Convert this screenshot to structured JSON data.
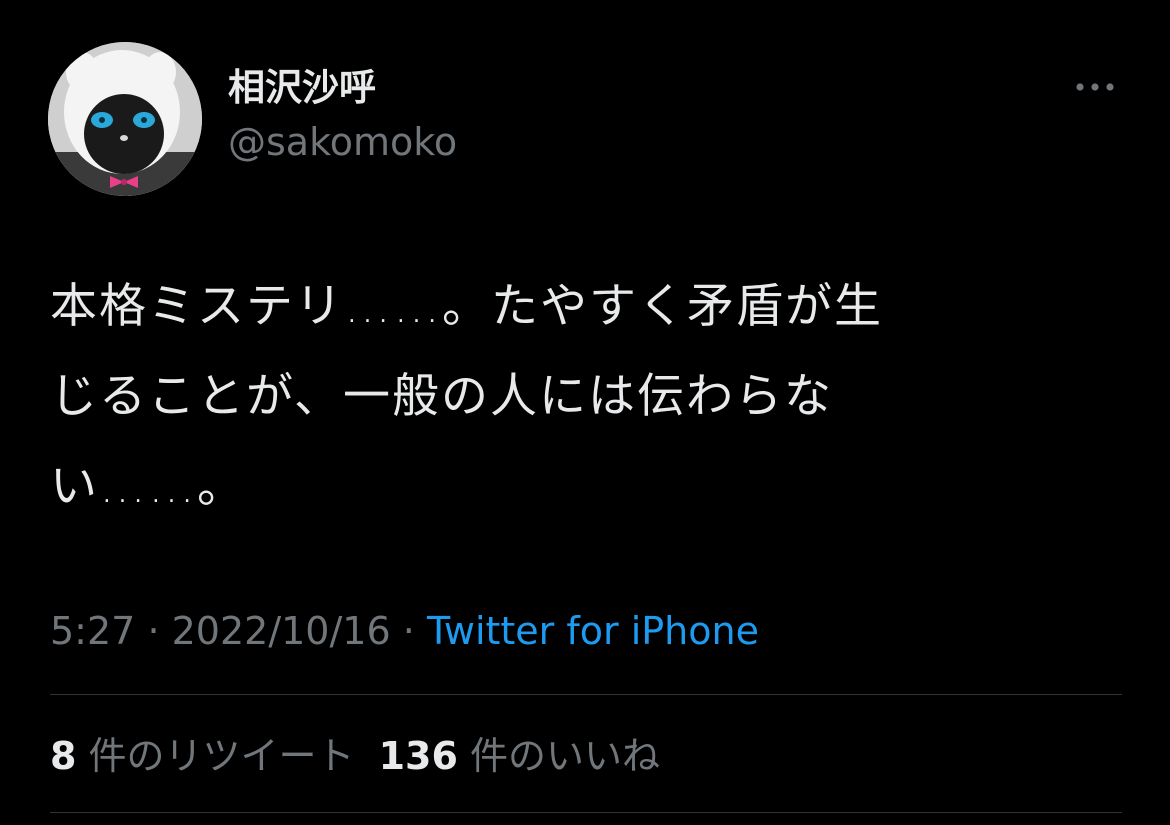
{
  "user": {
    "display_name": "相沢沙呼",
    "handle": "@sakomoko",
    "avatar_icon": "avatar-cat-plush"
  },
  "more_icon": "more-horizontal-icon",
  "tweet": {
    "text_lines": [
      "本格ミステリ……。たやすく矛盾が生",
      "じることが、一般の人には伝わらな",
      "い……。"
    ]
  },
  "meta": {
    "time": "5:27",
    "separator": "·",
    "date": "2022/10/16",
    "source": "Twitter for iPhone"
  },
  "stats": {
    "retweets_count": "8",
    "retweets_label": "件のリツイート",
    "likes_count": "136",
    "likes_label": "件のいいね"
  },
  "colors": {
    "background": "#000000",
    "primary_text": "#e7e9ea",
    "secondary_text": "#71767b",
    "link": "#1d9bf0",
    "divider": "#2f3336"
  }
}
